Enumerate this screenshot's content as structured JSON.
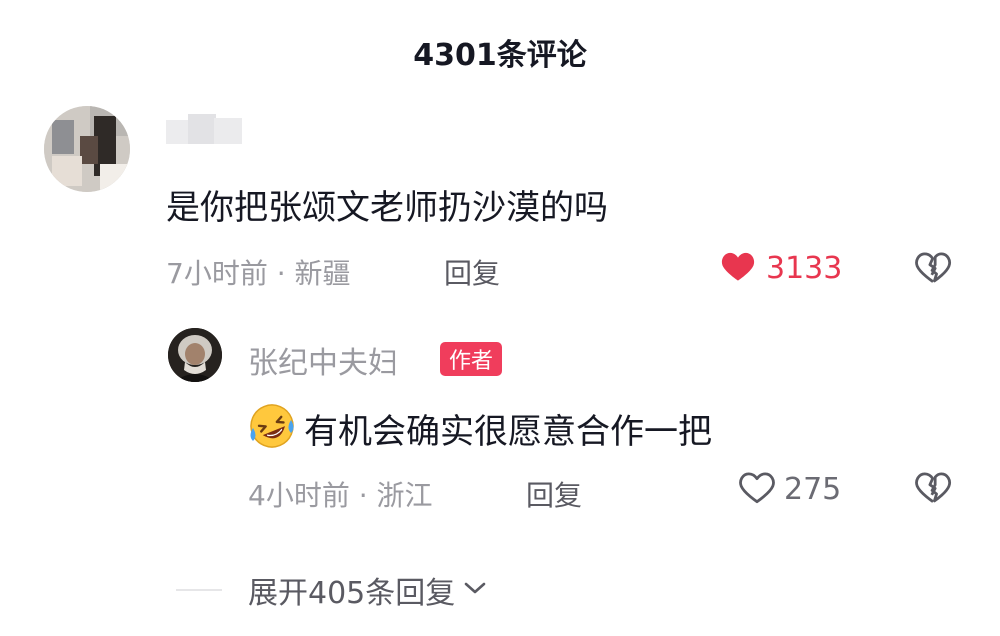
{
  "header": {
    "title": "4301条评论"
  },
  "comment": {
    "username": "",
    "text": "是你把张颂文老师扔沙漠的吗",
    "time": "7小时前",
    "separator": "·",
    "location": "新疆",
    "reply_label": "回复",
    "likes": "3133",
    "liked": true,
    "like_color": "#e8364f",
    "reply": {
      "username": "张纪中夫妇",
      "badge": "作者",
      "badge_color": "#f03d5c",
      "emoji": "rolling-laughing-emoji",
      "text": "有机会确实很愿意合作一把",
      "time": "4小时前",
      "separator": "·",
      "location": "浙江",
      "reply_label": "回复",
      "likes": "275",
      "liked": false
    },
    "expand_label": "展开405条回复"
  },
  "icons": {
    "like_filled": "heart-filled-icon",
    "like_outline": "heart-outline-icon",
    "dislike": "broken-heart-icon",
    "expand": "chevron-down-icon"
  }
}
